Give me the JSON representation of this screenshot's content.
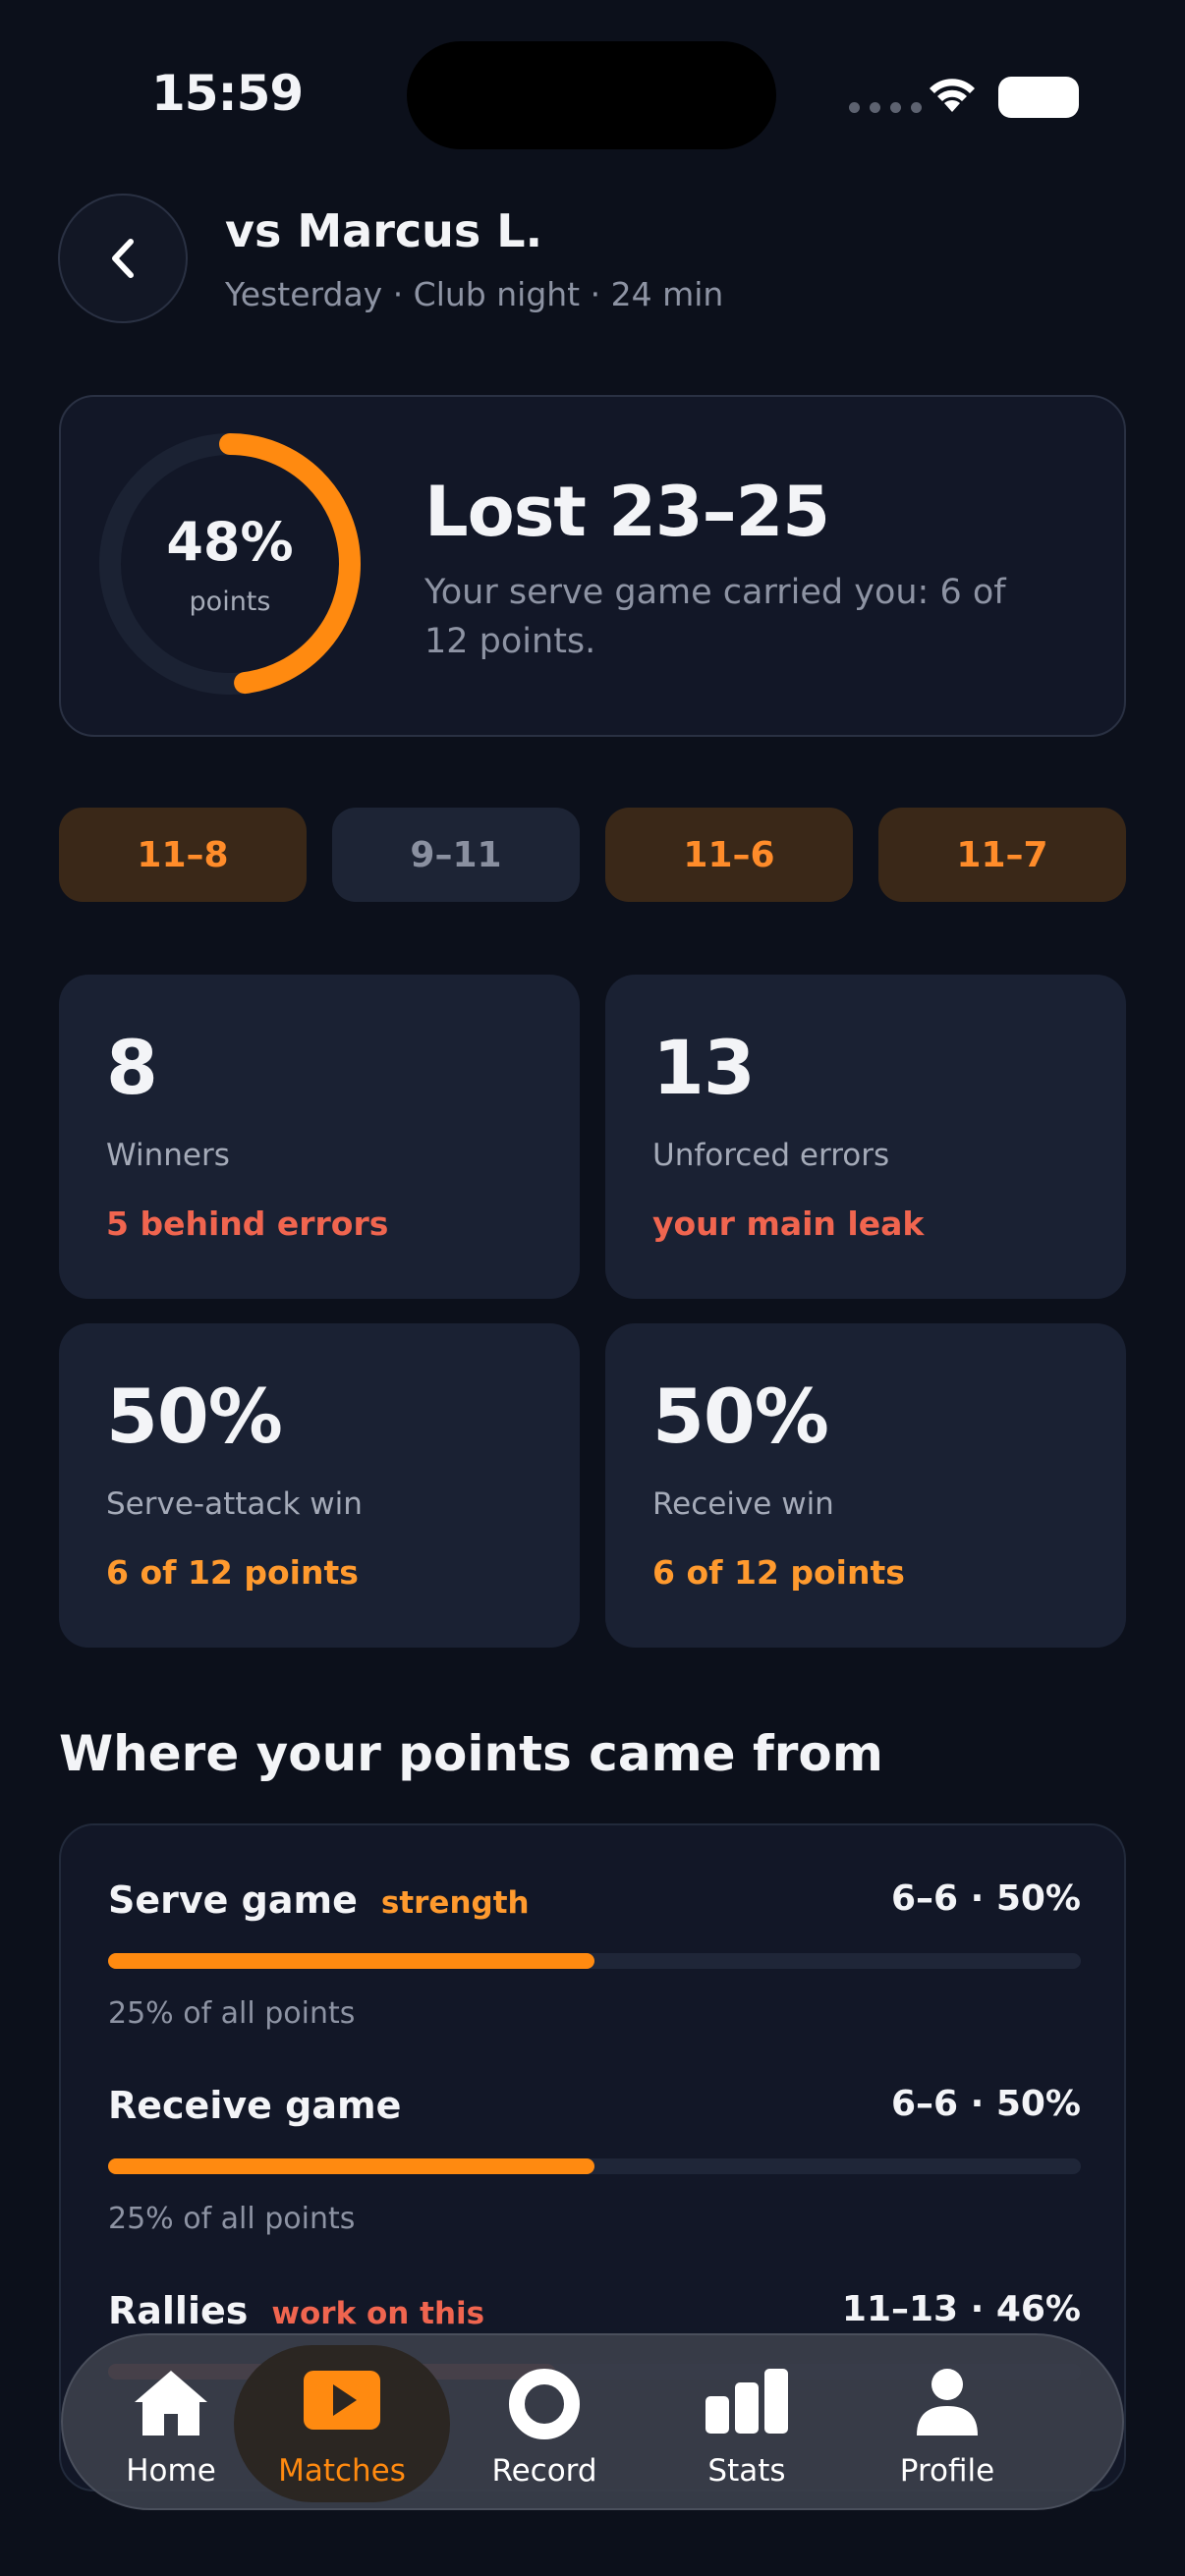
{
  "status_bar": {
    "time": "15:59"
  },
  "header": {
    "title": "vs Marcus L.",
    "subtitle": "Yesterday · Club night · 24 min"
  },
  "summary": {
    "points_pct": "48%",
    "points_fraction": 0.48,
    "points_label": "points",
    "result": "Lost 23–25",
    "note": "Your serve game carried you: 6 of 12 points."
  },
  "games": [
    {
      "score": "11–8",
      "outcome": "won"
    },
    {
      "score": "9–11",
      "outcome": "lost"
    },
    {
      "score": "11–6",
      "outcome": "won"
    },
    {
      "score": "11–7",
      "outcome": "won"
    }
  ],
  "stats": [
    {
      "value": "8",
      "label": "Winners",
      "note": "5 behind errors",
      "tone": "red"
    },
    {
      "value": "13",
      "label": "Unforced errors",
      "note": "your main leak",
      "tone": "red"
    },
    {
      "value": "50%",
      "label": "Serve-attack win",
      "note": "6 of 12 points",
      "tone": "orange"
    },
    {
      "value": "50%",
      "label": "Receive win",
      "note": "6 of 12 points",
      "tone": "orange"
    }
  ],
  "breakdown": {
    "title": "Where your points came from",
    "rows": [
      {
        "name": "Serve game",
        "tag": "strength",
        "score": "6–6 · 50%",
        "share": "25% of all points",
        "fill": 0.5
      },
      {
        "name": "Receive game",
        "tag": "",
        "score": "6–6 · 50%",
        "share": "25% of all points",
        "fill": 0.5
      },
      {
        "name": "Rallies",
        "tag": "work on this",
        "score": "11–13 · 46%",
        "share": "",
        "fill": 0.46
      }
    ]
  },
  "tabbar": {
    "tabs": [
      {
        "label": "Home",
        "icon": "home-icon"
      },
      {
        "label": "Matches",
        "icon": "play-icon",
        "active": true
      },
      {
        "label": "Record",
        "icon": "record-icon"
      },
      {
        "label": "Stats",
        "icon": "bar-chart-icon"
      },
      {
        "label": "Profile",
        "icon": "person-icon"
      }
    ]
  },
  "colors": {
    "accent": "#ff8a10",
    "negative": "#f0654f",
    "background": "#0c101b"
  }
}
